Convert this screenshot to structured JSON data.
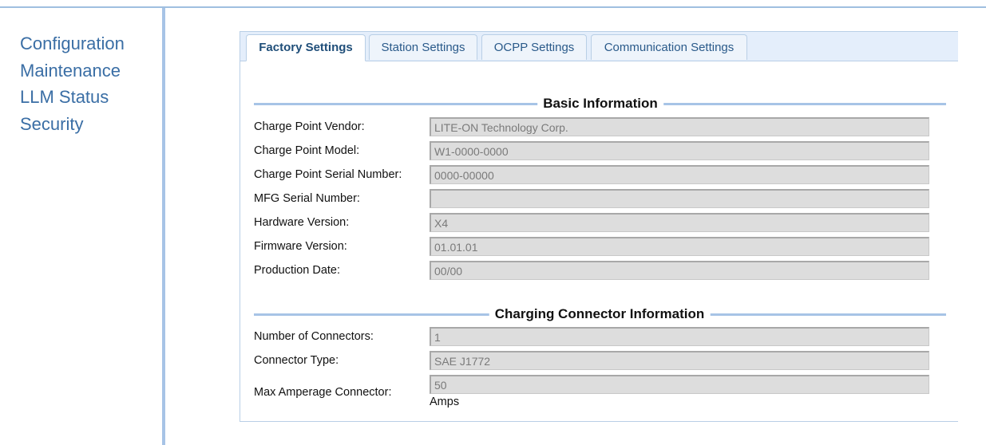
{
  "sidebar": {
    "items": [
      {
        "label": "Configuration"
      },
      {
        "label": "Maintenance"
      },
      {
        "label": "LLM Status"
      },
      {
        "label": "Security"
      }
    ]
  },
  "tabs": [
    {
      "label": "Factory Settings",
      "active": true
    },
    {
      "label": "Station Settings"
    },
    {
      "label": "OCPP Settings"
    },
    {
      "label": "Communication Settings"
    }
  ],
  "basic_info": {
    "title": "Basic Information",
    "fields": [
      {
        "label": "Charge Point Vendor:",
        "value": "LITE-ON Technology Corp."
      },
      {
        "label": "Charge Point Model:",
        "value": "W1-0000-0000"
      },
      {
        "label": "Charge Point Serial Number:",
        "value": "0000-00000"
      },
      {
        "label": "MFG Serial Number:",
        "value": ""
      },
      {
        "label": "Hardware Version:",
        "value": "X4"
      },
      {
        "label": "Firmware Version:",
        "value": "01.01.01"
      },
      {
        "label": "Production Date:",
        "value": "00/00"
      }
    ]
  },
  "connector_info": {
    "title": "Charging Connector Information",
    "fields": [
      {
        "label": "Number of Connectors:",
        "value": "1"
      },
      {
        "label": "Connector Type:",
        "value": "SAE J1772"
      },
      {
        "label": "Max Amperage Connector:",
        "value": "50",
        "units": "Amps"
      }
    ]
  },
  "colors": {
    "accent_line": "#a7c4e6",
    "nav_link": "#3a6ea5",
    "field_bg": "#dddddd"
  }
}
